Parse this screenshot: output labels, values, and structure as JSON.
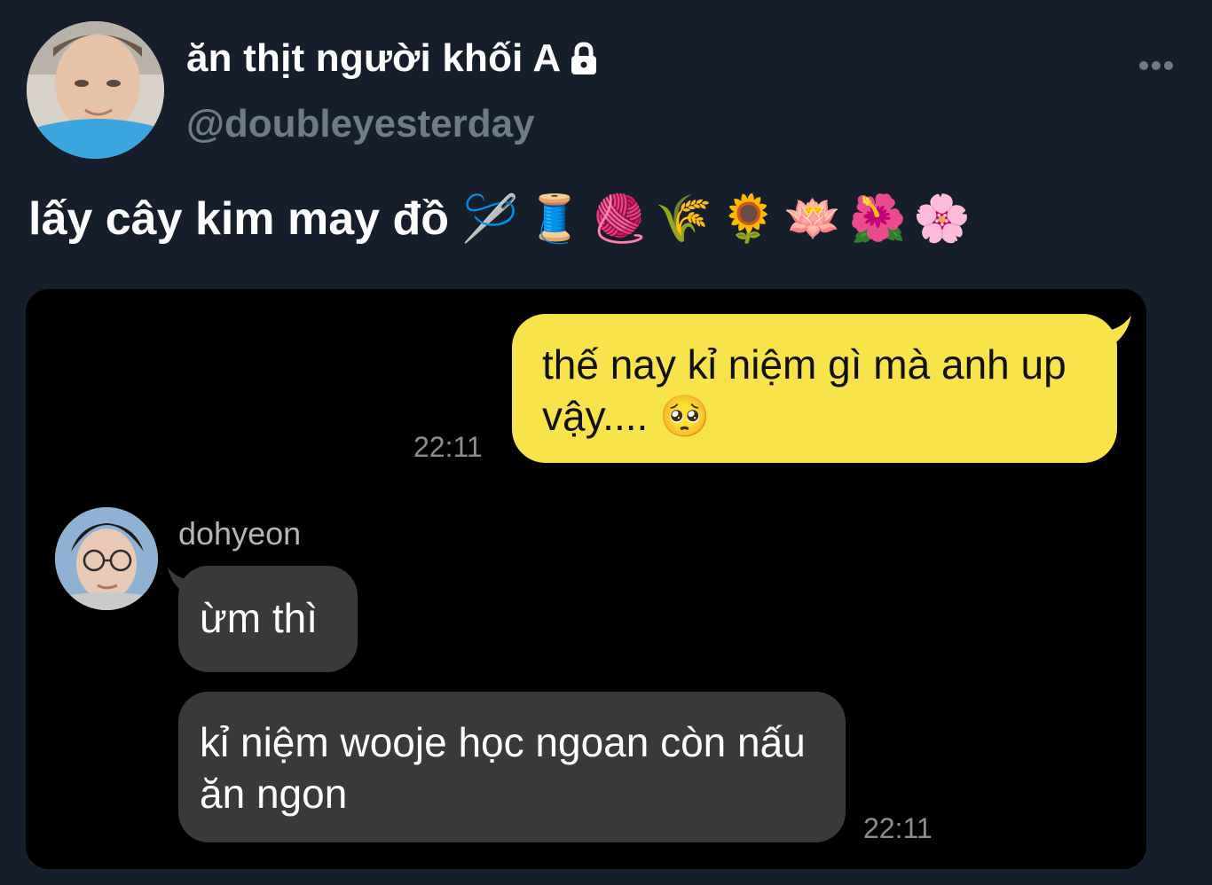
{
  "tweet": {
    "display_name": "ăn thịt người khối A",
    "handle": "@doubleyesterday",
    "text": "lấy cây kim may đồ",
    "emojis": [
      "🪡",
      "🧵",
      "🧶",
      "🌾",
      "🌻",
      "🪷",
      "🌺",
      "🌸"
    ],
    "icons": {
      "lock": "lock-icon",
      "more": "more-options-icon"
    }
  },
  "chat": {
    "outgoing": {
      "text": "thế nay kỉ niệm gì mà anh up vậy....",
      "emoji": "🥺",
      "time": "22:11",
      "color": "#f9e34b"
    },
    "contact_name": "dohyeon",
    "incoming": [
      {
        "text": "ừm thì"
      },
      {
        "text": "kỉ niệm wooje học ngoan còn nấu ăn ngon"
      }
    ],
    "incoming_time": "22:11"
  },
  "colors": {
    "background": "#151e2a",
    "handle": "#6e7b88",
    "incoming_bubble": "#3a3a3a"
  }
}
